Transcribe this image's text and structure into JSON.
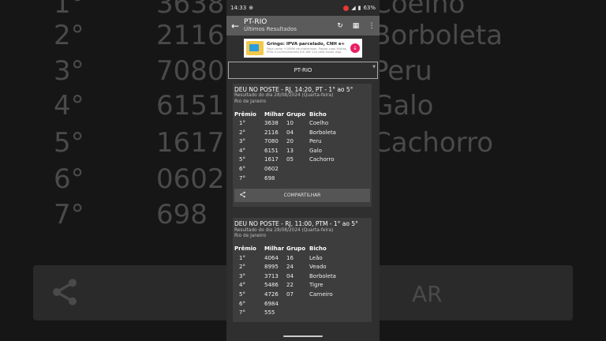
{
  "background": {
    "rows": [
      {
        "pos": "1°",
        "milhar": "3638",
        "bicho": "Coelho"
      },
      {
        "pos": "2°",
        "milhar": "2116",
        "bicho": "Borboleta"
      },
      {
        "pos": "3°",
        "milhar": "7080",
        "bicho": "Peru"
      },
      {
        "pos": "4°",
        "milhar": "6151",
        "bicho": "Galo"
      },
      {
        "pos": "5°",
        "milhar": "1617",
        "bicho": "Cachorro"
      },
      {
        "pos": "6°",
        "milhar": "0602",
        "bicho": ""
      },
      {
        "pos": "7°",
        "milhar": "698",
        "bicho": ""
      }
    ],
    "share_label_partial": "AR"
  },
  "status": {
    "time": "14:33",
    "battery": "63%"
  },
  "toolbar": {
    "title": "PT-RIO",
    "subtitle": "Últimos Resultados"
  },
  "ad": {
    "title": "Gringo: IPVA parcelado, CNH e+",
    "sub": "Faça como +10MM de motoristas. Pague suas Multas, IPVA e Licenciamento Em Até 12x pelo Super App."
  },
  "select": {
    "value": "PT-RIO"
  },
  "cards": [
    {
      "title": "DEU NO POSTE - RJ, 14:20, PT - 1° ao 5°",
      "date": "Resultado do dia 28/08/2024 (Quarta-feira)",
      "place": "Rio de Janeiro",
      "headers": [
        "Prêmio",
        "Milhar",
        "Grupo",
        "Bicho"
      ],
      "rows": [
        [
          "1°",
          "3638",
          "10",
          "Coelho"
        ],
        [
          "2°",
          "2116",
          "04",
          "Borboleta"
        ],
        [
          "3°",
          "7080",
          "20",
          "Peru"
        ],
        [
          "4°",
          "6151",
          "13",
          "Galo"
        ],
        [
          "5°",
          "1617",
          "05",
          "Cachorro"
        ],
        [
          "6°",
          "0602",
          "",
          ""
        ],
        [
          "7°",
          "698",
          "",
          ""
        ]
      ],
      "share_label": "COMPARTILHAR"
    },
    {
      "title": "DEU NO POSTE - RJ, 11:00, PTM - 1° ao 5°",
      "date": "Resultado do dia 28/08/2024 (Quarta-feira)",
      "place": "Rio de Janeiro",
      "headers": [
        "Prêmio",
        "Milhar",
        "Grupo",
        "Bicho"
      ],
      "rows": [
        [
          "1°",
          "4064",
          "16",
          "Leão"
        ],
        [
          "2°",
          "8995",
          "24",
          "Veado"
        ],
        [
          "3°",
          "3713",
          "04",
          "Borboleta"
        ],
        [
          "4°",
          "5486",
          "22",
          "Tigre"
        ],
        [
          "5°",
          "4726",
          "07",
          "Carneiro"
        ],
        [
          "6°",
          "6984",
          "",
          ""
        ],
        [
          "7°",
          "555",
          "",
          ""
        ]
      ]
    }
  ]
}
